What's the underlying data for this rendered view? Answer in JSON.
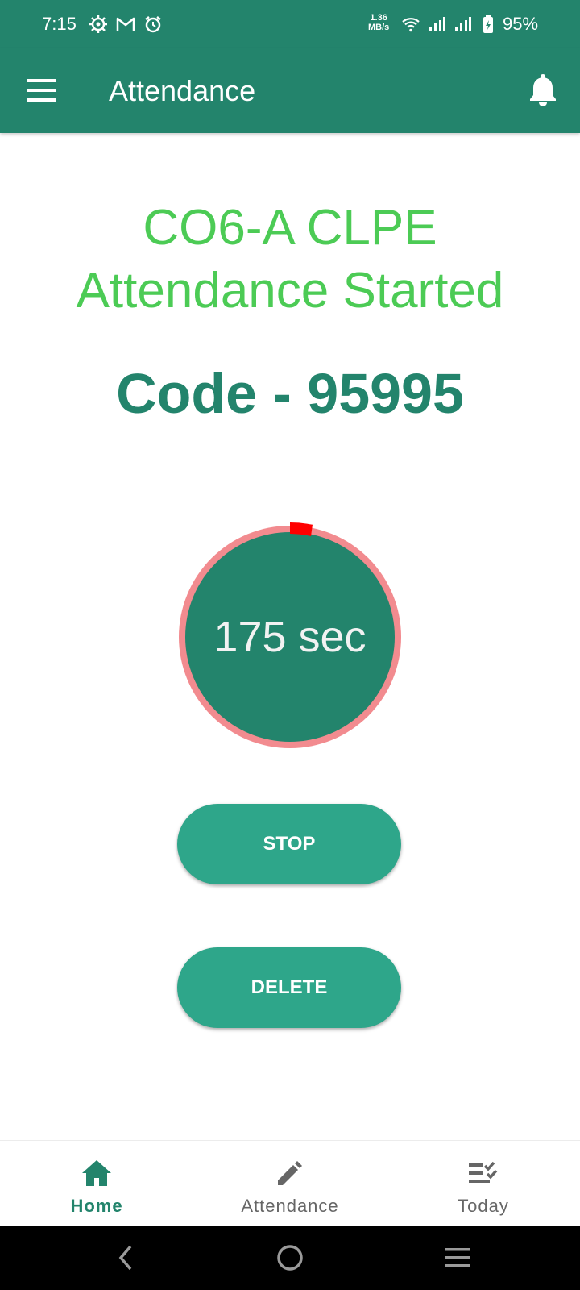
{
  "status_bar": {
    "time": "7:15",
    "net_speed_value": "1.36",
    "net_speed_unit": "MB/s",
    "battery": "95%",
    "icons": [
      "settings-icon",
      "gmail-icon",
      "alarm-icon",
      "wifi-icon",
      "signal-icon",
      "signal-icon",
      "battery-charging-icon"
    ]
  },
  "app_bar": {
    "title": "Attendance",
    "menu_icon": "menu-icon",
    "notification_icon": "bell-icon"
  },
  "session": {
    "title_line1": "CO6-A CLPE",
    "title_line2": "Attendance Started",
    "code": "Code - 95995"
  },
  "timer": {
    "label": "175 sec",
    "colors": {
      "fill": "#23846c",
      "ring": "#f28b8f",
      "marker": "#ff0000"
    }
  },
  "buttons": {
    "stop": "STOP",
    "delete": "DELETE"
  },
  "bottom_nav": {
    "items": [
      {
        "label": "Home",
        "icon": "home-icon",
        "active": true
      },
      {
        "label": "Attendance",
        "icon": "pencil-icon",
        "active": false
      },
      {
        "label": "Today",
        "icon": "checklist-icon",
        "active": false
      }
    ]
  },
  "colors": {
    "primary": "#23846c",
    "button": "#2ea68a",
    "title_green": "#4ccb55"
  }
}
